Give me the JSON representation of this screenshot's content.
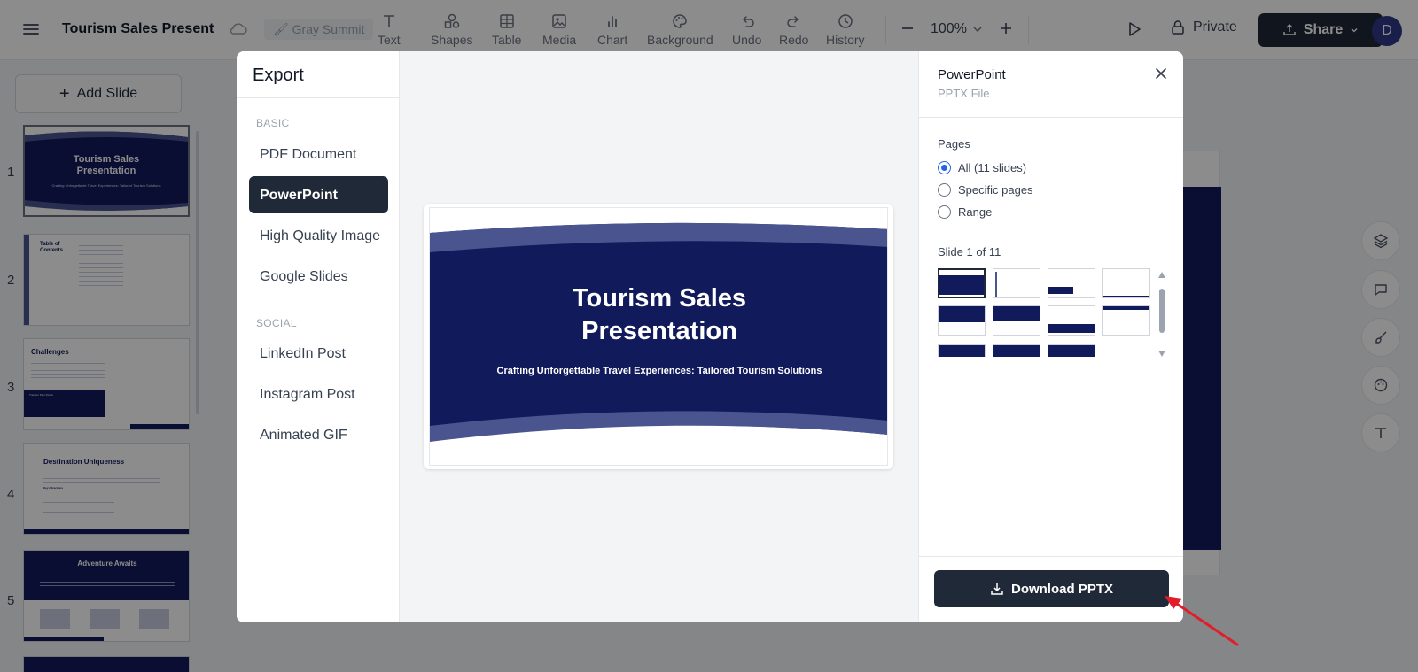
{
  "topbar": {
    "doc_title": "Tourism Sales Presentati",
    "theme": "Gray Summit",
    "tools": [
      {
        "label": "Text",
        "icon": "text-icon"
      },
      {
        "label": "Shapes",
        "icon": "shapes-icon"
      },
      {
        "label": "Table",
        "icon": "table-icon"
      },
      {
        "label": "Media",
        "icon": "media-icon"
      },
      {
        "label": "Chart",
        "icon": "chart-icon"
      },
      {
        "label": "Background",
        "icon": "palette-icon"
      },
      {
        "label": "Undo",
        "icon": "undo-icon"
      },
      {
        "label": "Redo",
        "icon": "redo-icon"
      },
      {
        "label": "History",
        "icon": "history-icon"
      }
    ],
    "zoom": "100%",
    "private_label": "Private",
    "share_label": "Share",
    "avatar_initial": "D"
  },
  "sidebar": {
    "add_slide_label": "Add Slide",
    "slides": [
      {
        "num": "1",
        "title": "Tourism Sales Presentation",
        "subtitle": "Crafting Unforgettable Travel Experiences: Tailored Tourism Solutions"
      },
      {
        "num": "2",
        "title": "Table of Contents"
      },
      {
        "num": "3",
        "title": "Challenges",
        "subtitle": "Traveler Pain Points"
      },
      {
        "num": "4",
        "title": "Destination Uniqueness",
        "subtitle": "Key Attractions"
      },
      {
        "num": "5",
        "title": "Adventure Awaits"
      }
    ]
  },
  "modal": {
    "title": "Export",
    "sections": {
      "basic": "BASIC",
      "social": "SOCIAL"
    },
    "basic_formats": [
      "PDF Document",
      "PowerPoint",
      "High Quality Image",
      "Google Slides"
    ],
    "social_formats": [
      "LinkedIn Post",
      "Instagram Post",
      "Animated GIF"
    ],
    "active_format": "PowerPoint",
    "preview": {
      "title_line1": "Tourism Sales",
      "title_line2": "Presentation",
      "subtitle": "Crafting Unforgettable Travel Experiences: Tailored Tourism Solutions"
    },
    "right": {
      "title": "PowerPoint",
      "subtitle": "PPTX File",
      "pages_label": "Pages",
      "options": [
        "All (11 slides)",
        "Specific pages",
        "Range"
      ],
      "selected_option": "All (11 slides)",
      "slide_count": "Slide 1 of 11",
      "download_label": "Download PPTX"
    }
  },
  "colors": {
    "navy": "#111a5b",
    "wave": "#4a5590",
    "dark_button": "#1f2937",
    "radio_accent": "#2563eb",
    "arrow": "#e11d2a"
  }
}
